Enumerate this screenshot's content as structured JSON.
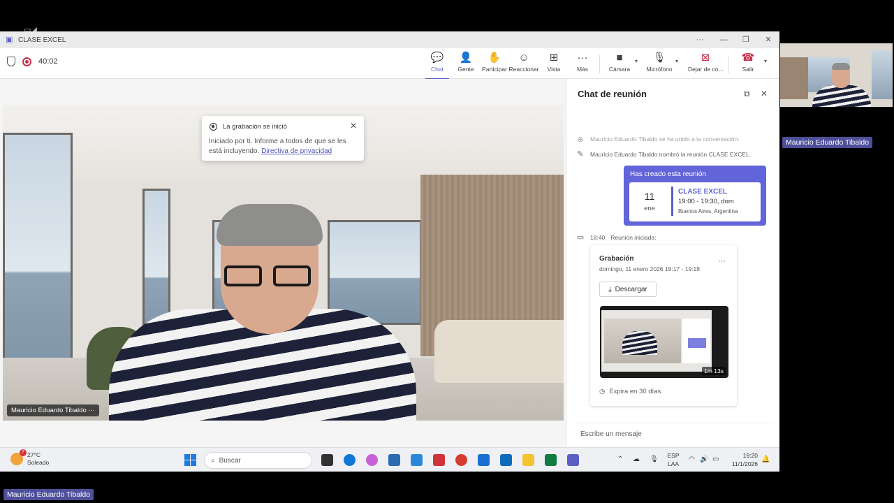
{
  "window": {
    "title": "CLASE EXCEL",
    "controls": [
      "···",
      "—",
      "❐",
      "✕"
    ]
  },
  "toolbar": {
    "timer": "40:02",
    "buttons": [
      {
        "label": "Chat",
        "icon": "chat-icon",
        "glyph": "💬"
      },
      {
        "label": "Gente",
        "icon": "people-icon",
        "glyph": "👤"
      },
      {
        "label": "Participar",
        "icon": "raise-hand-icon",
        "glyph": "✋"
      },
      {
        "label": "Reaccionar",
        "icon": "smiley-icon",
        "glyph": "☺"
      },
      {
        "label": "Vista",
        "icon": "grid-view-icon",
        "glyph": "⊞"
      },
      {
        "label": "Más",
        "icon": "more-icon",
        "glyph": "···"
      },
      {
        "label": "Cámara",
        "icon": "camera-icon",
        "glyph": "■"
      },
      {
        "label": "Micrófono",
        "icon": "microphone-icon",
        "glyph": "🎙"
      },
      {
        "label": "Dejar de co...",
        "icon": "stop-share-icon",
        "glyph": "⊠"
      },
      {
        "label": "Salir",
        "icon": "hang-up-icon",
        "glyph": "☎"
      }
    ]
  },
  "video": {
    "participant_name": "Mauricio Eduardo Tibaldo ···"
  },
  "toast": {
    "title": "La grabación se inició",
    "body": "Iniciado por ti. Informe a todos de que se les está incluyendo.",
    "link": "Directiva de privacidad",
    "close": "✕"
  },
  "chat": {
    "title": "Chat de reunión",
    "sys_top": "Mauricio Eduardo Tibaldo se ha unido a la conversación.",
    "sys_renamed": "Mauricio Eduardo Tibaldo nombró la reunión CLASE EXCEL.",
    "meeting_card": {
      "header": "Has creado esta reunión",
      "day": "11",
      "month": "ene",
      "name": "CLASE EXCEL",
      "time": "19:00 - 19:30, dom",
      "location": "Buenos Aires, Argentina"
    },
    "started": {
      "time": "18:40",
      "text": "Reunión iniciada:"
    },
    "recording": {
      "title": "Grabación",
      "date": "domingo, 11 enero 2026 19:17 - 19:18",
      "download": "Descargar",
      "duration": "1m 13s",
      "expires": "Expira en 30 días."
    },
    "composer_placeholder": "Escribe un mensaje"
  },
  "taskbar": {
    "temp": "27°C",
    "weather": "Soleado",
    "search": "Buscar",
    "lang1": "ESP",
    "lang2": "LAA",
    "time": "19:20",
    "date": "11/1/2026"
  },
  "pip": {
    "name": "Mauricio Eduardo Tibaldo"
  },
  "bottom_name": "Mauricio Eduardo Tibaldo",
  "colors": {
    "accent": "#5b5fc7",
    "record": "#c4314b",
    "hangup": "#c4314b"
  }
}
